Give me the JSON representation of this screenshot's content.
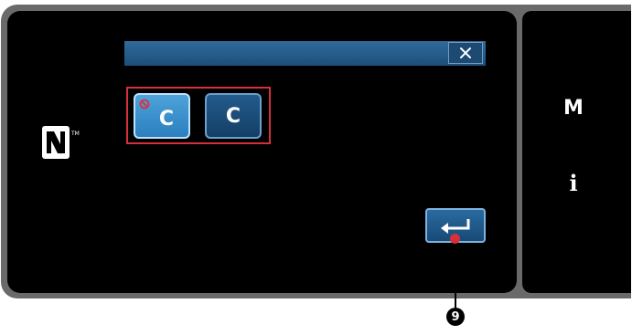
{
  "dialog": {
    "close_icon": "close-icon"
  },
  "selection": {
    "buttons": [
      {
        "label": "C",
        "state": "selected",
        "badge_icon": "prohibited-icon"
      },
      {
        "label": "C",
        "state": "normal"
      }
    ],
    "highlight_color": "#d8303a"
  },
  "nfc": {
    "icon": "nfc-n-mark-icon"
  },
  "enter": {
    "icon": "enter-return-icon"
  },
  "side_panel": {
    "m_label": "M",
    "info_label": "i"
  },
  "callout": {
    "number": "9"
  },
  "colors": {
    "accent_blue": "#2b7fbf",
    "dark_blue": "#143f66",
    "titlebar_blue": "#1d4f7a",
    "callout_red": "#d8303a"
  }
}
